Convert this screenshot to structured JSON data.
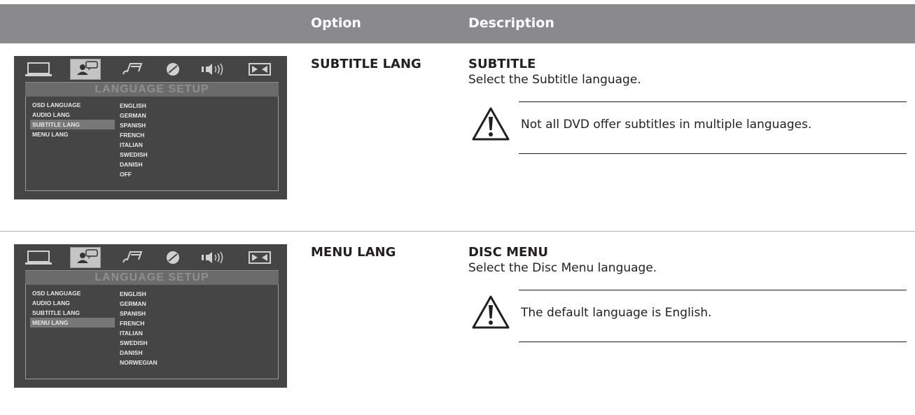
{
  "header": {
    "col_option": "Option",
    "col_description": "Description"
  },
  "osd": {
    "title": "LANGUAGE SETUP",
    "menu_items": [
      "OSD LANGUAGE",
      "AUDIO LANG",
      "SUBTITLE LANG",
      "MENU LANG"
    ]
  },
  "rows": [
    {
      "option": "SUBTITLE LANG",
      "title": "SUBTITLE",
      "text": "Select the Subtitle language.",
      "note": "Not all DVD offer subtitles in multiple languages.",
      "selected_item": "SUBTITLE LANG",
      "languages": [
        "ENGLISH",
        "GERMAN",
        "SPANISH",
        "FRENCH",
        "ITALIAN",
        "SWEDISH",
        "DANISH",
        "OFF"
      ]
    },
    {
      "option": "MENU LANG",
      "title": "DISC MENU",
      "text": "Select the Disc Menu language.",
      "note": "The default language is English.",
      "selected_item": "MENU LANG",
      "languages": [
        "ENGLISH",
        "GERMAN",
        "SPANISH",
        "FRENCH",
        "ITALIAN",
        "SWEDISH",
        "DANISH",
        "NORWEGIAN"
      ]
    }
  ],
  "icons": [
    "monitor-icon",
    "language-person-icon",
    "music-note-icon",
    "disc-icon",
    "speaker-icon",
    "dolby-icon",
    "warning-icon"
  ]
}
